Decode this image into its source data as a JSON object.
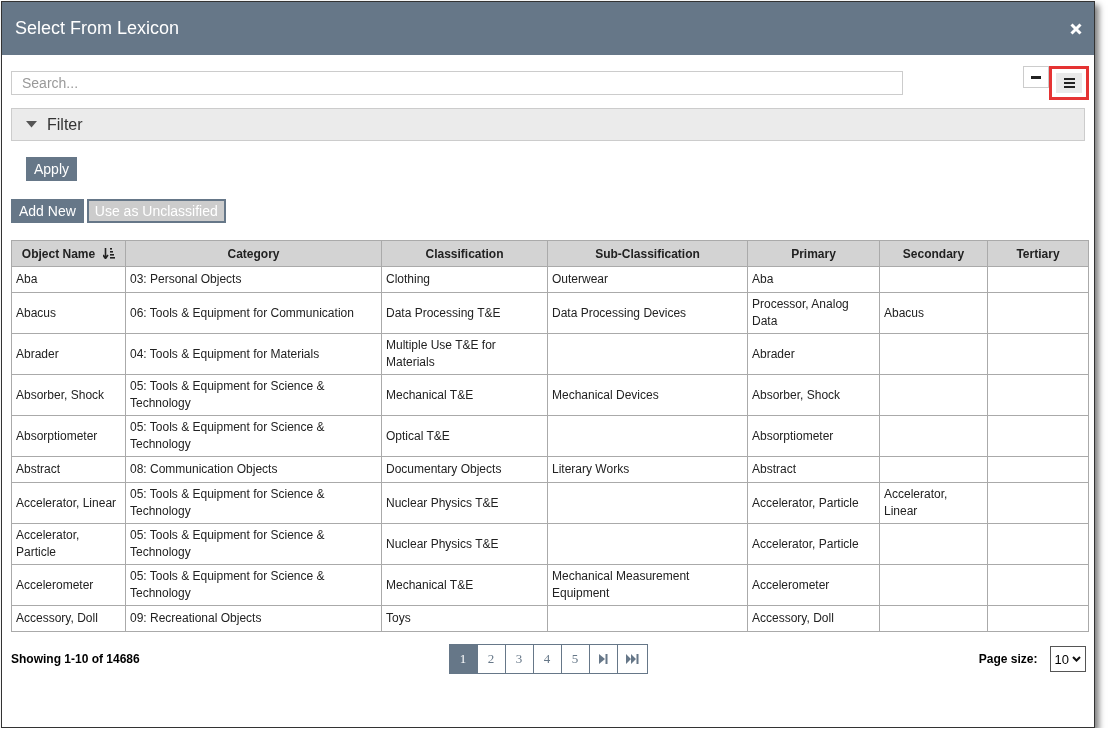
{
  "dialog": {
    "title": "Select From Lexicon"
  },
  "search": {
    "placeholder": "Search..."
  },
  "view_buttons": [
    {
      "kind": "collapse",
      "selected": false,
      "highlighted": false
    },
    {
      "kind": "list",
      "selected": true,
      "highlighted": true
    }
  ],
  "filter": {
    "label": "Filter",
    "expanded": true
  },
  "apply_button": "Apply",
  "actions": [
    {
      "label": "Add New",
      "disabled": false
    },
    {
      "label": "Use as Unclassified",
      "disabled": true
    }
  ],
  "table": {
    "columns": [
      {
        "label": "Object Name",
        "sorted": true
      },
      {
        "label": "Category",
        "sorted": false
      },
      {
        "label": "Classification",
        "sorted": false
      },
      {
        "label": "Sub-Classification",
        "sorted": false
      },
      {
        "label": "Primary",
        "sorted": false
      },
      {
        "label": "Secondary",
        "sorted": false
      },
      {
        "label": "Tertiary",
        "sorted": false
      }
    ],
    "rows": [
      [
        "Aba",
        "03: Personal Objects",
        "Clothing",
        "Outerwear",
        "Aba",
        "",
        ""
      ],
      [
        "Abacus",
        "06: Tools & Equipment for Communication",
        "Data Processing T&E",
        "Data Processing Devices",
        "Processor, Analog Data",
        "Abacus",
        ""
      ],
      [
        "Abrader",
        "04: Tools & Equipment for Materials",
        "Multiple Use T&E for Materials",
        "",
        "Abrader",
        "",
        ""
      ],
      [
        "Absorber, Shock",
        "05: Tools & Equipment for Science & Technology",
        "Mechanical T&E",
        "Mechanical Devices",
        "Absorber, Shock",
        "",
        ""
      ],
      [
        "Absorptiometer",
        "05: Tools & Equipment for Science & Technology",
        "Optical T&E",
        "",
        "Absorptiometer",
        "",
        ""
      ],
      [
        "Abstract",
        "08: Communication Objects",
        "Documentary Objects",
        "Literary Works",
        "Abstract",
        "",
        ""
      ],
      [
        "Accelerator, Linear",
        "05: Tools & Equipment for Science & Technology",
        "Nuclear Physics T&E",
        "",
        "Accelerator, Particle",
        "Accelerator, Linear",
        ""
      ],
      [
        "Accelerator, Particle",
        "05: Tools & Equipment for Science & Technology",
        "Nuclear Physics T&E",
        "",
        "Accelerator, Particle",
        "",
        ""
      ],
      [
        "Accelerometer",
        "05: Tools & Equipment for Science & Technology",
        "Mechanical T&E",
        "Mechanical Measurement Equipment",
        "Accelerometer",
        "",
        ""
      ],
      [
        "Accessory, Doll",
        "09: Recreational Objects",
        "Toys",
        "",
        "Accessory, Doll",
        "",
        ""
      ]
    ]
  },
  "footer": {
    "showing": "Showing 1-10 of 14686",
    "pages": [
      {
        "label": "1",
        "selected": true
      },
      {
        "label": "2",
        "selected": false
      },
      {
        "label": "3",
        "selected": false
      },
      {
        "label": "4",
        "selected": false
      },
      {
        "label": "5",
        "selected": false
      }
    ],
    "page_size_label": "Page size:",
    "page_size": "10"
  }
}
